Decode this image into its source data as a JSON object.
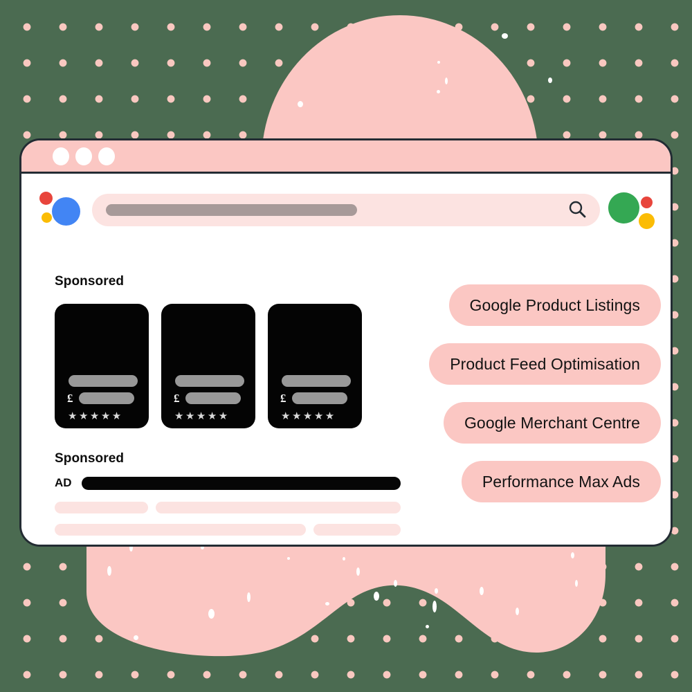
{
  "background": {
    "color": "#4b6b51",
    "dot_color": "#f9c8c0",
    "blob_color": "#fbc7c3"
  },
  "window": {
    "titlebar": {
      "buttons": [
        "window-dot-1",
        "window-dot-2",
        "window-dot-3"
      ],
      "color": "#fbc7c3"
    },
    "border_color": "#232c33"
  },
  "search": {
    "placeholder": "",
    "value": "",
    "icon": "search-icon",
    "left_logo_dots": [
      {
        "name": "red-dot",
        "color": "#e8453c"
      },
      {
        "name": "yellow-dot",
        "color": "#fbbc05"
      },
      {
        "name": "blue-dot",
        "color": "#4285f4"
      }
    ],
    "right_logo_dots": [
      {
        "name": "green-dot",
        "color": "#34a853"
      },
      {
        "name": "red-dot",
        "color": "#e8453c"
      },
      {
        "name": "yellow-dot",
        "color": "#fbbc05"
      }
    ]
  },
  "main": {
    "shopping_label": "Sponsored",
    "product_cards": [
      {
        "currency": "£",
        "stars": "★★★★★"
      },
      {
        "currency": "£",
        "stars": "★★★★★"
      },
      {
        "currency": "£",
        "stars": "★★★★★"
      }
    ],
    "text_ad_label": "Sponsored",
    "ad_badge": "AD",
    "skeleton_lines": [
      [
        145,
        270
      ],
      [
        355,
        115
      ],
      [
        490
      ]
    ]
  },
  "pills": [
    {
      "label": "Google Product Listings"
    },
    {
      "label": "Product Feed Optimisation"
    },
    {
      "label": "Google Merchant Centre"
    },
    {
      "label": "Performance Max Ads"
    }
  ]
}
